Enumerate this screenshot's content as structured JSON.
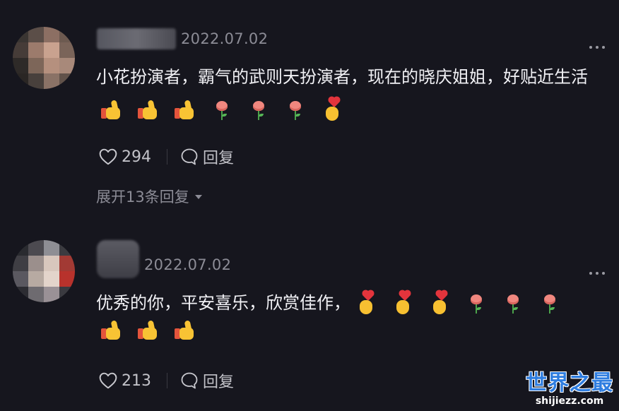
{
  "comments": [
    {
      "date": "2022.07.02",
      "text": "小花扮演者，霸气的武则天扮演者，现在的晓庆姐姐，好贴近生活",
      "emojis": [
        "thumbs-up",
        "thumbs-up",
        "thumbs-up",
        "rose",
        "rose",
        "rose",
        "heart-hand"
      ],
      "likes": "294",
      "reply_label": "回复",
      "expand_replies": "展开13条回复",
      "avatar_colors": [
        "#3a3532",
        "#5b4e48",
        "#8c6f63",
        "#6d5a50",
        "#463c38",
        "#9c7b6c",
        "#c9a28f",
        "#7a6459",
        "#2e2a28",
        "#7d6659",
        "#b5907e",
        "#a8897a",
        "#2a2624",
        "#48403c",
        "#8a7266",
        "#61524a"
      ]
    },
    {
      "date": "2022.07.02",
      "text": "优秀的你，平安喜乐，欣赏佳作，",
      "emojis_inline": [
        "heart-hand",
        "heart-hand",
        "heart-hand",
        "rose",
        "rose",
        "rose"
      ],
      "emojis_next": [
        "thumbs-up",
        "thumbs-up",
        "thumbs-up"
      ],
      "likes": "213",
      "reply_label": "回复",
      "avatar_colors": [
        "#2a2b30",
        "#4c4a50",
        "#8e8e94",
        "#3b3b40",
        "#3f3e44",
        "#9b8f8c",
        "#d8c7bd",
        "#a23a34",
        "#5a5860",
        "#b7aaa2",
        "#e3d4cb",
        "#b8322c",
        "#2c2c32",
        "#6e6b70",
        "#9a9196",
        "#3a3a40"
      ]
    }
  ],
  "watermark": {
    "main": "世界之最",
    "sub": "shijiezz.com"
  },
  "colors": {
    "background": "#16161e",
    "text": "#f1f1f5",
    "muted": "#8c8c96",
    "watermark": "#2e7de0"
  }
}
